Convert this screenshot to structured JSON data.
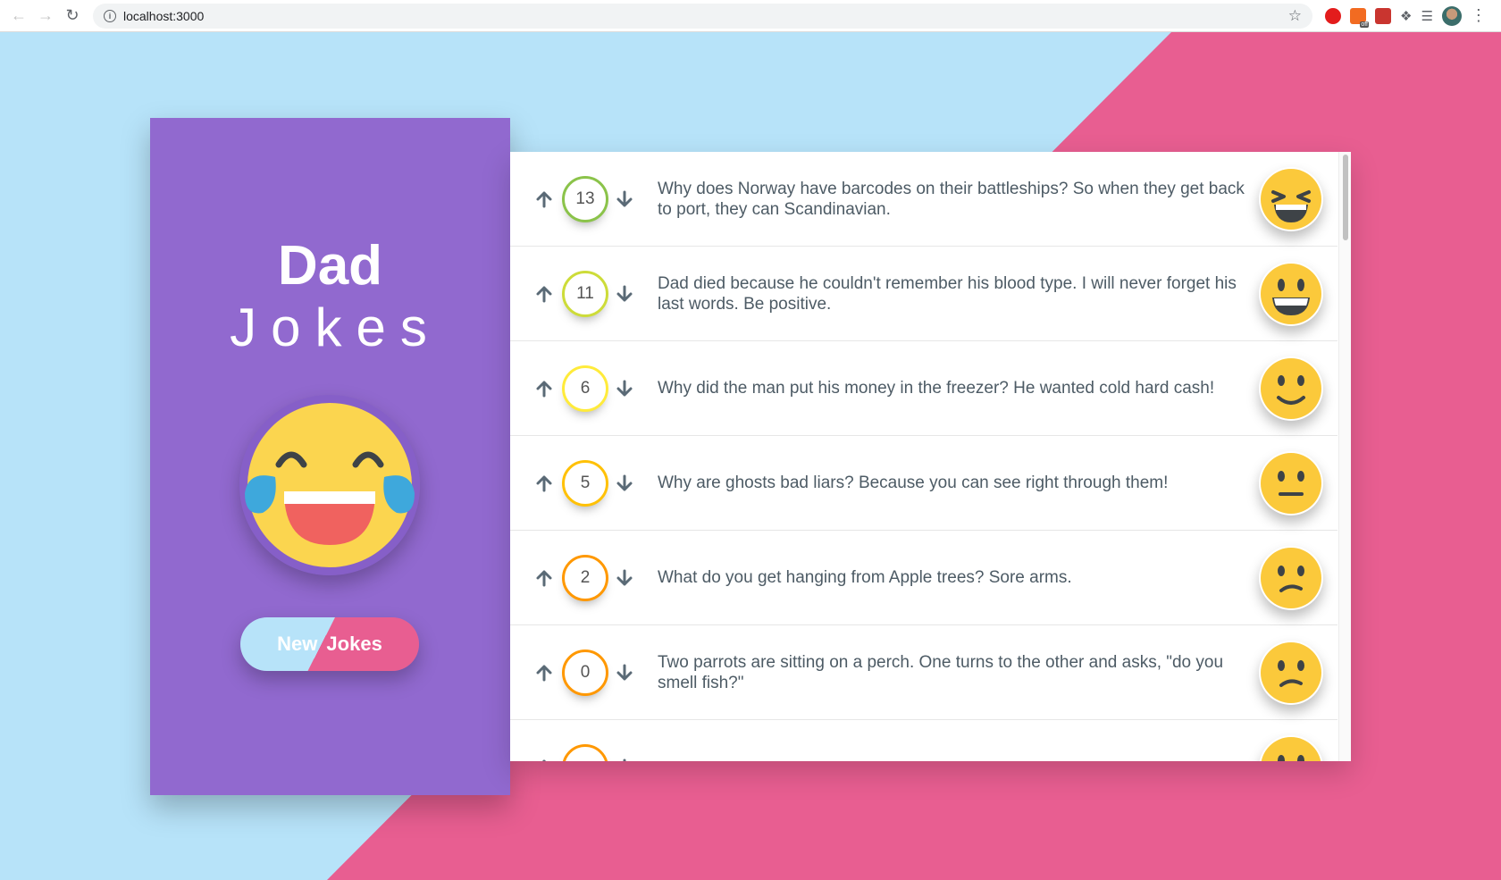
{
  "browser": {
    "url": "localhost:3000",
    "extension_badge": "off"
  },
  "sidebar": {
    "title_strong": "Dad",
    "title_light": "Jokes",
    "button_new": "New",
    "button_jokes": "Jokes",
    "colors": {
      "panel": "#9169cf",
      "button_left": "#b7e3f9",
      "button_right": "#e85e91"
    }
  },
  "jokes": [
    {
      "votes": "13",
      "text": "Why does Norway have barcodes on their battleships? So when they get back to port, they can Scandinavian.",
      "ring_color": "#8bc34a",
      "face": "laughing-squint"
    },
    {
      "votes": "11",
      "text": "Dad died because he couldn't remember his blood type. I will never forget his last words. Be positive.",
      "ring_color": "#cddc39",
      "face": "grinning"
    },
    {
      "votes": "6",
      "text": "Why did the man put his money in the freezer? He wanted cold hard cash!",
      "ring_color": "#ffeb3b",
      "face": "smile"
    },
    {
      "votes": "5",
      "text": "Why are ghosts bad liars? Because you can see right through them!",
      "ring_color": "#ffc107",
      "face": "neutral"
    },
    {
      "votes": "2",
      "text": "What do you get hanging from Apple trees? Sore arms.",
      "ring_color": "#ff9800",
      "face": "confused"
    },
    {
      "votes": "0",
      "text": "Two parrots are sitting on a perch. One turns to the other and asks, \"do you smell fish?\"",
      "ring_color": "#ff9800",
      "face": "confused"
    },
    {
      "votes": "",
      "text": "",
      "ring_color": "#ff9800",
      "face": "confused"
    }
  ]
}
